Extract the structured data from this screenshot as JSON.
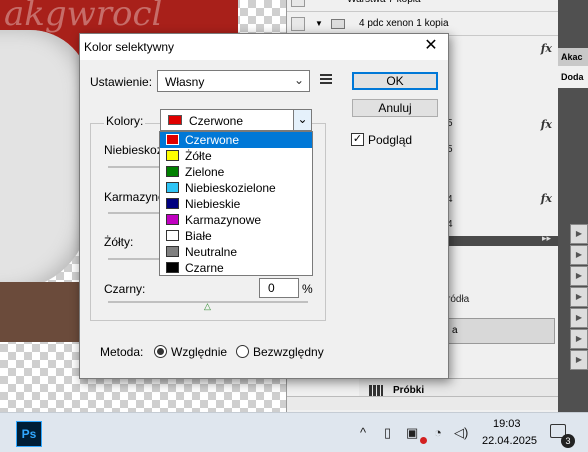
{
  "background": {
    "canvas_watermark": "akgwrocl",
    "layers": [
      {
        "name": "Warstwa 7 kopia"
      },
      {
        "name": "4 pdc xenon 1 kopia"
      }
    ],
    "fragments": [
      "5",
      "5",
      "4",
      "4",
      "ródła",
      "a"
    ],
    "panel_collapse": "▸▸",
    "swatches_panel": "Próbki",
    "right_panel": {
      "tab": "Akac",
      "subtab": "Doda"
    }
  },
  "dialog": {
    "title": "Kolor selektywny",
    "preset_label": "Ustawienie:",
    "preset_value": "Własny",
    "ok": "OK",
    "cancel": "Anuluj",
    "preview_label": "Podgląd",
    "preview_checked": true,
    "colors_label": "Kolory:",
    "colors_value": "Czerwone",
    "colors_swatch": "#e00000",
    "sliders": [
      {
        "label": "Niebieskozielone:"
      },
      {
        "label": "Karmazynowy:"
      },
      {
        "label": "Żółty:"
      },
      {
        "label": "Czarny:",
        "value": "0",
        "unit": "%"
      }
    ],
    "method_label": "Metoda:",
    "method_options": [
      "Względnie",
      "Bezwzględny"
    ],
    "method_selected": "Względnie"
  },
  "dropdown": {
    "selected_index": 0,
    "options": [
      {
        "label": "Czerwone",
        "color": "#e00000"
      },
      {
        "label": "Żółte",
        "color": "#ffff00"
      },
      {
        "label": "Zielone",
        "color": "#008000"
      },
      {
        "label": "Niebieskozielone",
        "color": "#2ec4f5"
      },
      {
        "label": "Niebieskie",
        "color": "#000080"
      },
      {
        "label": "Karmazynowe",
        "color": "#c000c0"
      },
      {
        "label": "Białe",
        "color": "#ffffff"
      },
      {
        "label": "Neutralne",
        "color": "#808080"
      },
      {
        "label": "Czarne",
        "color": "#000000"
      }
    ]
  },
  "taskbar": {
    "app_label": "Ps",
    "time": "19:03",
    "date": "22.04.2025",
    "notification_count": "3",
    "tray_icons": [
      "chevron-up-icon",
      "phone-link-icon",
      "screen-icon",
      "wifi-icon",
      "volume-icon"
    ]
  }
}
